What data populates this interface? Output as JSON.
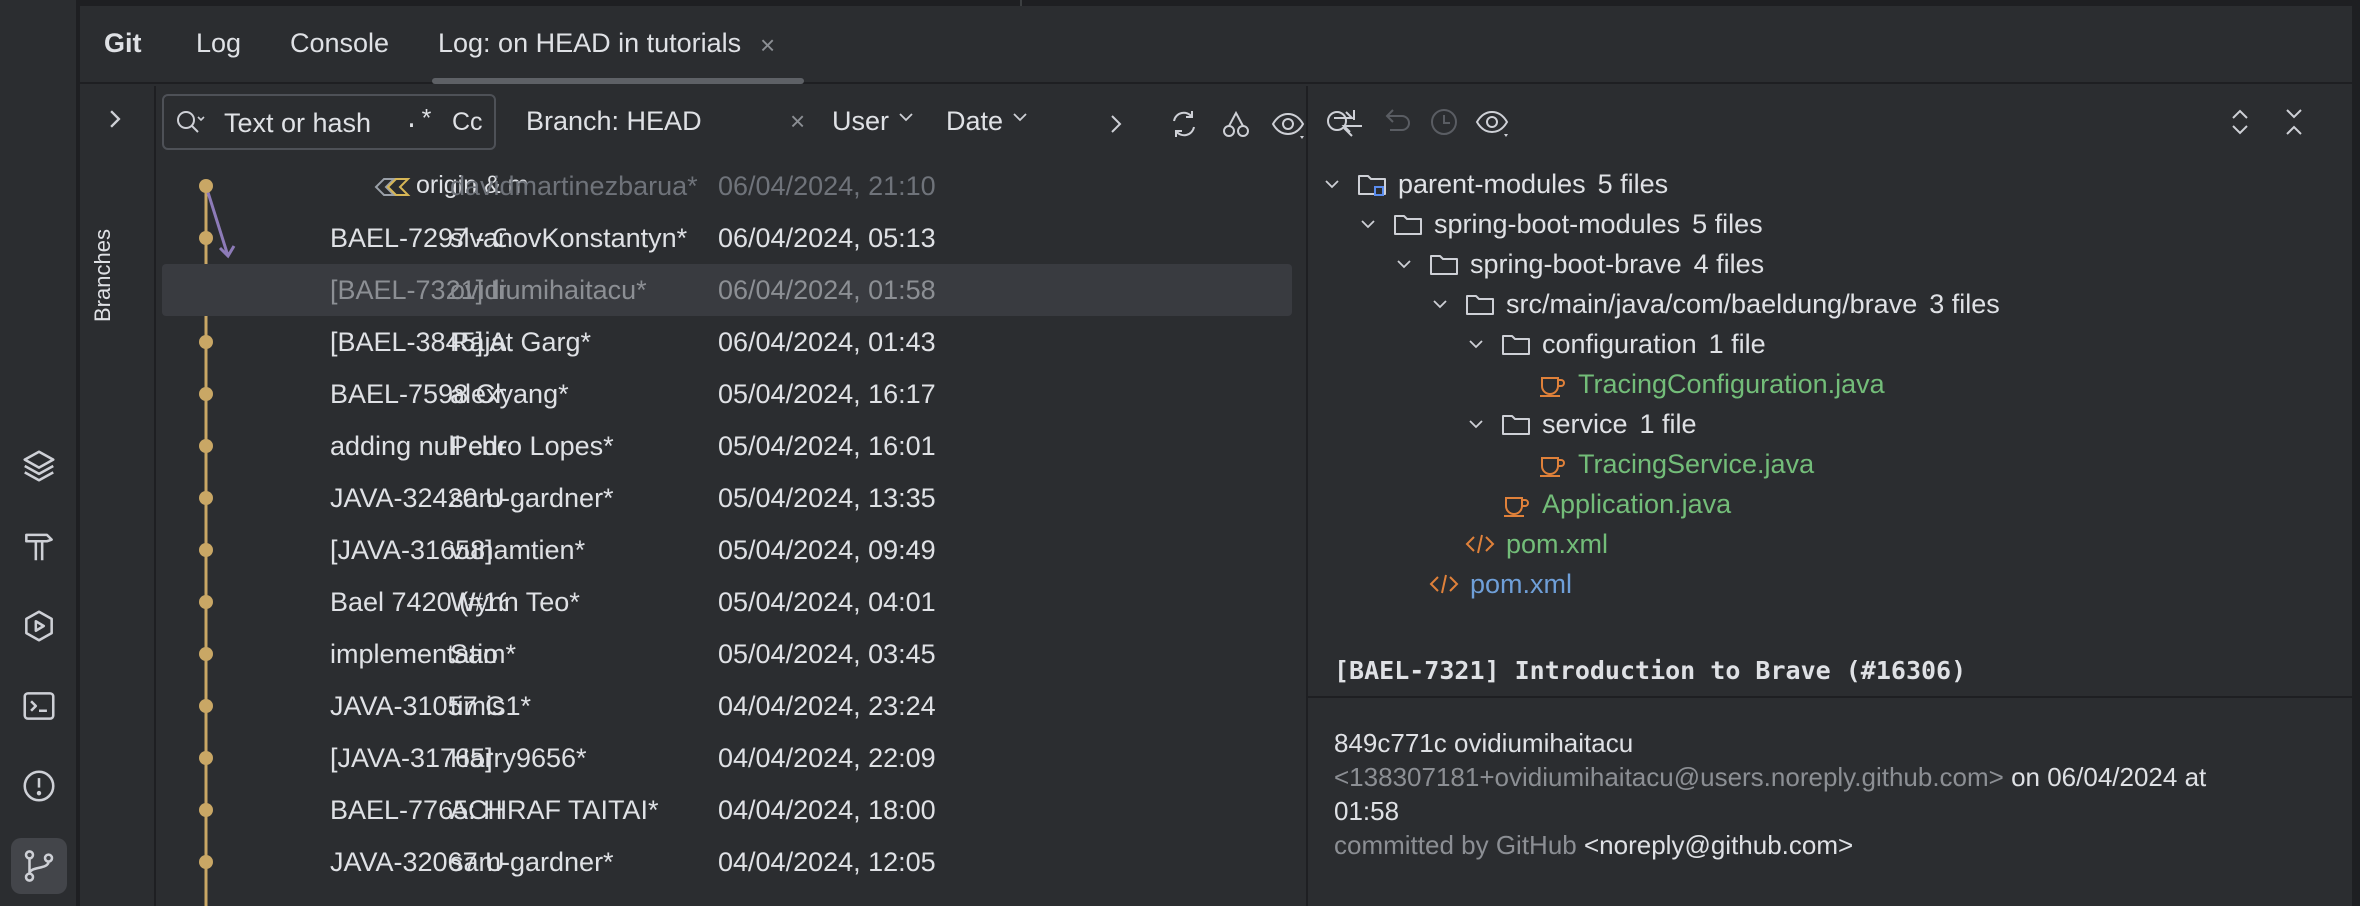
{
  "tabs": {
    "git": "Git",
    "log": "Log",
    "console": "Console",
    "active": "Log: on HEAD in tutorials",
    "close": "×"
  },
  "sidebar": {
    "branches_label": "Branches"
  },
  "toolbar": {
    "search_placeholder": "Text or hash",
    "regex": ".*",
    "case": "Cc",
    "branch_filter": "Branch: HEAD",
    "branch_clear": "×",
    "user_filter": "User",
    "date_filter": "Date"
  },
  "commits": [
    {
      "subject": "origin & m",
      "author": "davidmartinezbarua*",
      "date": "06/04/2024, 21:10"
    },
    {
      "subject": "BAEL-7297 - C",
      "author": "slvanovKonstantyn*",
      "date": "06/04/2024, 05:13"
    },
    {
      "subject": "[BAEL-7321] In",
      "author": "ovidiumihaitacu*",
      "date": "06/04/2024, 01:58"
    },
    {
      "subject": "[BAEL-3845] A",
      "author": "Rajat Garg*",
      "date": "06/04/2024, 01:43"
    },
    {
      "subject": "BAEL-7598 Ch",
      "author": "alexyang*",
      "date": "05/04/2024, 16:17"
    },
    {
      "subject": "adding null che",
      "author": "Pedro Lopes*",
      "date": "05/04/2024, 16:01"
    },
    {
      "subject": "JAVA-32420 U",
      "author": "sam-gardner*",
      "date": "05/04/2024, 13:35"
    },
    {
      "subject": "[JAVA-31658]",
      "author": "vunamtien*",
      "date": "05/04/2024, 09:49"
    },
    {
      "subject": "Bael 7420 (#16",
      "author": "Wynn Teo*",
      "date": "05/04/2024, 04:01"
    },
    {
      "subject": "implementatio",
      "author": "Sam*",
      "date": "05/04/2024, 03:45"
    },
    {
      "subject": "JAVA-31057 C",
      "author": "timis1*",
      "date": "04/04/2024, 23:24"
    },
    {
      "subject": "[JAVA-31765]",
      "author": "Harry9656*",
      "date": "04/04/2024, 22:09"
    },
    {
      "subject": "BAEL-7765: H",
      "author": "ACHRAF TAITAI*",
      "date": "04/04/2024, 18:00"
    },
    {
      "subject": "JAVA-32067 U",
      "author": "sam-gardner*",
      "date": "04/04/2024, 12:05"
    }
  ],
  "tree": [
    {
      "name": "parent-modules",
      "count": "5 files"
    },
    {
      "name": "spring-boot-modules",
      "count": "5 files"
    },
    {
      "name": "spring-boot-brave",
      "count": "4 files"
    },
    {
      "name": "src/main/java/com/baeldung/brave",
      "count": "3 files"
    },
    {
      "name": "configuration",
      "count": "1 file"
    },
    {
      "name": "TracingConfiguration.java"
    },
    {
      "name": "service",
      "count": "1 file"
    },
    {
      "name": "TracingService.java"
    },
    {
      "name": "Application.java"
    },
    {
      "name": "pom.xml"
    },
    {
      "name": "pom.xml"
    }
  ],
  "details": {
    "title": "[BAEL-7321] Introduction to Brave (#16306)",
    "hash_author": "849c771c ovidiumihaitacu",
    "email": "<138307181+ovidiumihaitacu@users.noreply.github.com>",
    "on_date": "on 06/04/2024 at",
    "time": "01:58",
    "committed_by": "committed by GitHub",
    "committer_email": "<noreply@github.com>"
  },
  "colors": {
    "graph": "#c9a765",
    "graph_merge": "#8d7bb8",
    "added": "#73bd79",
    "modified": "#6f9fd8"
  }
}
